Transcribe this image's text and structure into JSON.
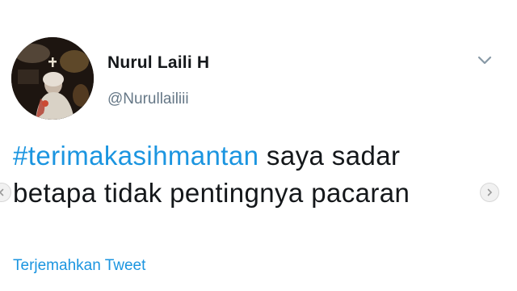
{
  "tweet": {
    "display_name": "Nurul Laili H",
    "handle": "@Nurullailiii",
    "hashtag": "#terimakasihmantan",
    "text_line1_rest": " saya sadar",
    "text_line2": "betapa tidak pentingnya pacaran",
    "translate_label": "Terjemahkan Tweet"
  },
  "icons": {
    "more": "chevron-down-icon",
    "prev": "chevron-left-icon",
    "next": "chevron-right-icon"
  },
  "colors": {
    "link": "#1b95e0",
    "text": "#14171a",
    "secondary": "#657786"
  }
}
